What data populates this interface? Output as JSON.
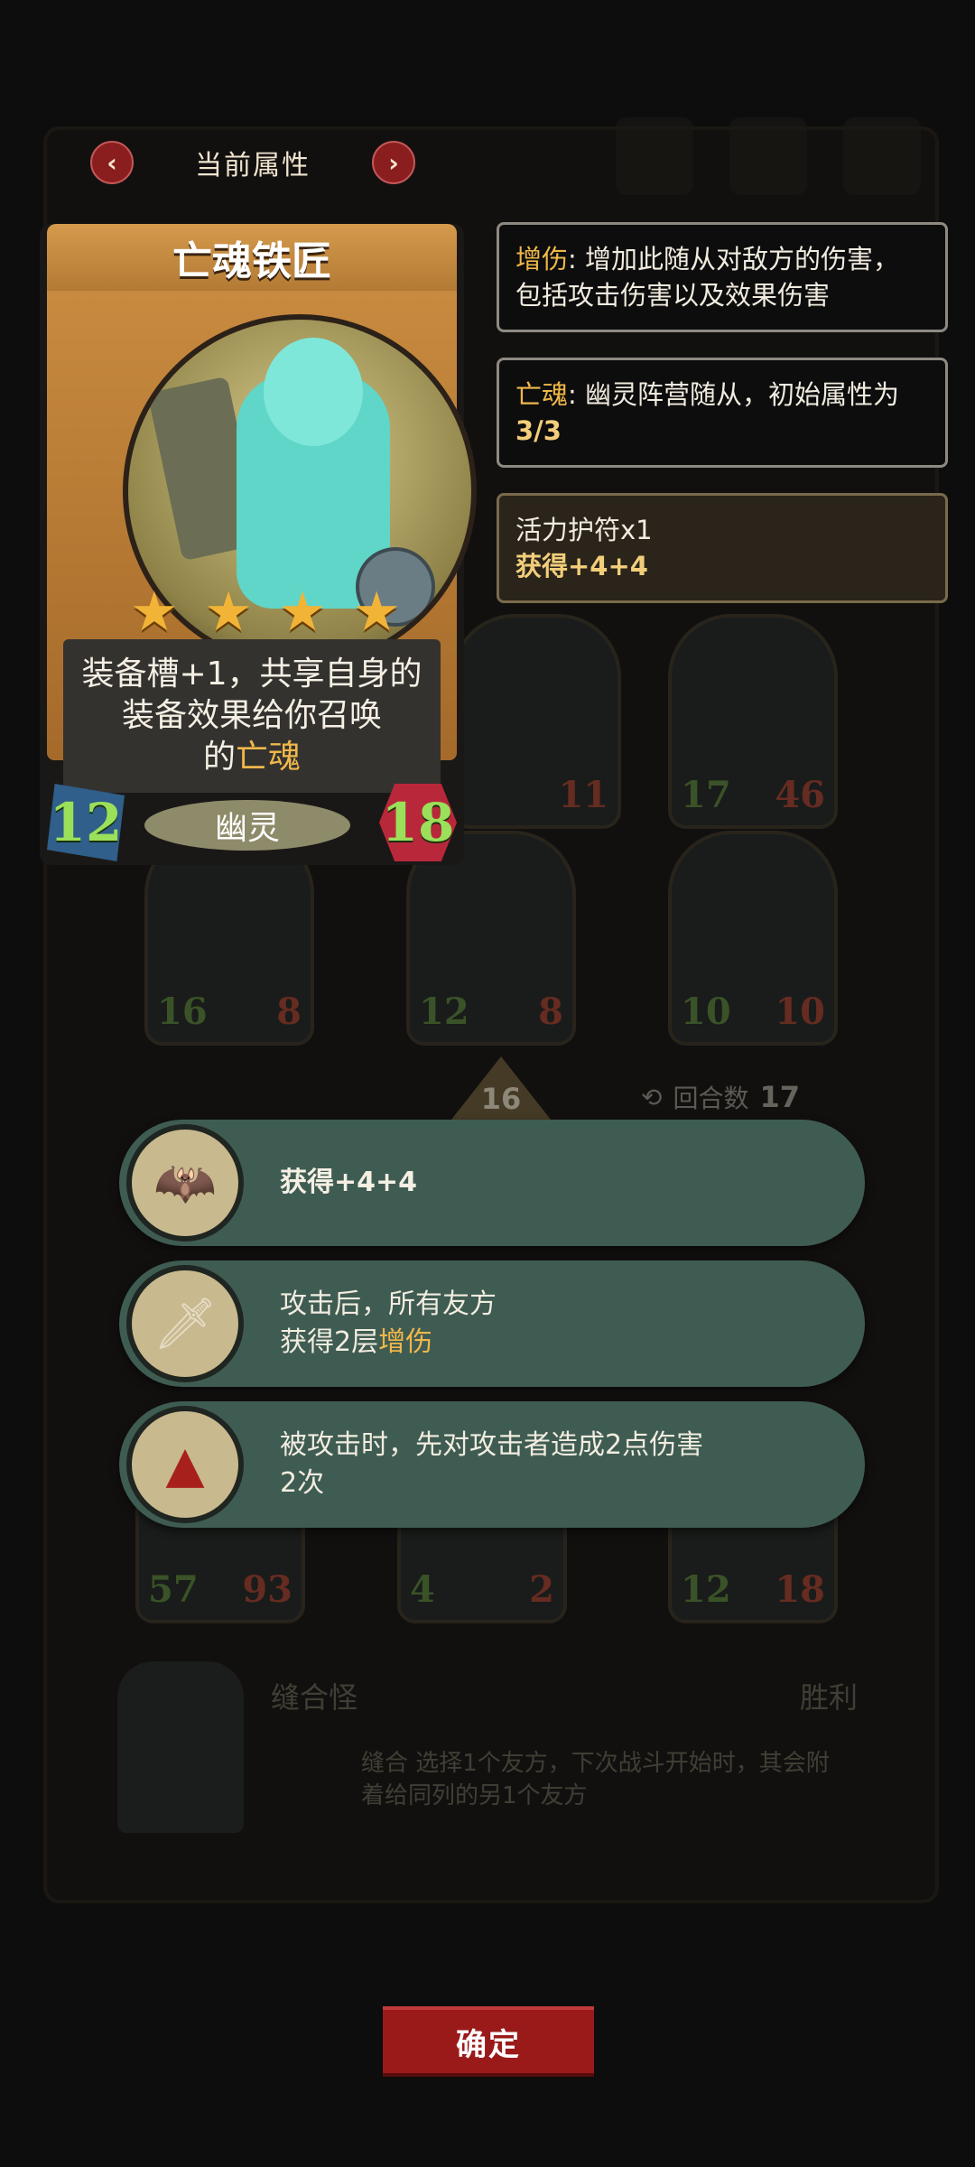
{
  "header": {
    "title": "当前属性",
    "prev": "‹",
    "next": "›"
  },
  "card": {
    "name": "亡魂铁匠",
    "stars": 4,
    "desc_line1": "装备槽+1，共享自身的",
    "desc_line2": "装备效果给你召唤",
    "desc_line3_pre": "的",
    "desc_line3_kw": "亡魂",
    "attack": "12",
    "health": "18",
    "tribe": "幽灵"
  },
  "tooltips": [
    {
      "kw": "增伤",
      "text": ": 增加此随从对敌方的伤害，",
      "line2": "包括攻击伤害以及效果伤害"
    },
    {
      "kw": "亡魂",
      "text": ": 幽灵阵营随从，初始属性为",
      "line2": "3/3"
    },
    {
      "title": "活力护符x1",
      "line2": "获得+4+4"
    }
  ],
  "board": {
    "round_label": "回合数",
    "round_value": "17",
    "arrow_value": "16",
    "tiles": [
      {
        "l": "",
        "r": "11"
      },
      {
        "l": "17",
        "r": "46"
      },
      {
        "l": "16",
        "r": "8"
      },
      {
        "l": "12",
        "r": "8"
      },
      {
        "l": "10",
        "r": "10"
      },
      {
        "l": "57",
        "r": "93"
      },
      {
        "l": "4",
        "r": "2"
      },
      {
        "l": "12",
        "r": "18"
      }
    ]
  },
  "effects": [
    {
      "icon": "bat-amulet-icon",
      "line1": "获得+4+4",
      "line2": ""
    },
    {
      "icon": "dagger-icon",
      "line1": "攻击后，所有友方",
      "line2_pre": "获得2层",
      "line2_kw": "增伤"
    },
    {
      "icon": "red-cloak-icon",
      "line1": "被攻击时，先对攻击者造成2点伤害",
      "line2": "2次"
    }
  ],
  "monster": {
    "name": "缝合怪",
    "result": "胜利",
    "desc": "缝合 选择1个友方，下次战斗开始时，其会附着给同列的另1个友方",
    "count": "0"
  },
  "confirm": "确定"
}
